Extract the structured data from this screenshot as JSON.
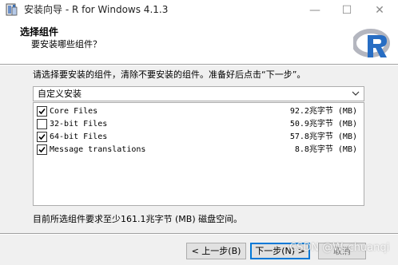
{
  "window": {
    "title": "安装向导 - R for Windows 4.1.3",
    "icon": "installer-icon",
    "controls": {
      "minimize": "—",
      "maximize": "☐",
      "close": "✕"
    }
  },
  "header": {
    "title": "选择组件",
    "subtitle": "要安装哪些组件？",
    "logo": "r-logo"
  },
  "body": {
    "instruction": "请选择要安装的组件，清除不要安装的组件。准备好后点击“下一步”。",
    "install_type": {
      "selected": "自定义安装"
    },
    "components": [
      {
        "name": "Core Files",
        "size": "92.2兆字节 (MB)",
        "checked": true
      },
      {
        "name": "32-bit Files",
        "size": "50.9兆字节 (MB)",
        "checked": false
      },
      {
        "name": "64-bit Files",
        "size": "57.8兆字节 (MB)",
        "checked": true
      },
      {
        "name": "Message translations",
        "size": "8.8兆字节 (MB)",
        "checked": true
      }
    ],
    "space_required": "目前所选组件要求至少161.1兆字节 (MB) 磁盘空间。"
  },
  "footer": {
    "back_label": "< 上一步(B)",
    "next_label": "下一步(N) >",
    "cancel_label": "取消"
  },
  "watermark": "CSDN @W_chuanqi",
  "colors": {
    "accent": "#0078d7",
    "panel": "#f0f0f0",
    "r_blue": "#276dc3",
    "r_gray": "#b4b6bf"
  }
}
